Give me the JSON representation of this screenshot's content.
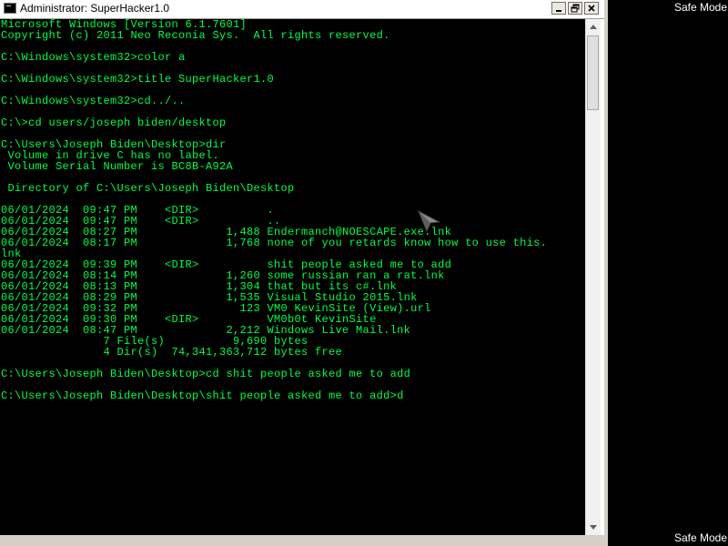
{
  "desktop": {
    "safe_mode_top": "Safe Mode",
    "safe_mode_bottom": "Safe Mode"
  },
  "window": {
    "title": "Administrator:  SuperHacker1.0",
    "buttons": {
      "minimize": "minimize-icon",
      "maximize": "maximize-icon",
      "close": "close-icon"
    }
  },
  "console": {
    "text_color": "#00ff40",
    "background": "#000000",
    "lines": [
      "Microsoft Windows [Version 6.1.7601]",
      "Copyright (c) 2011 Neo Reconia Sys.  All rights reserved.",
      "",
      "C:\\Windows\\system32>color a",
      "",
      "C:\\Windows\\system32>title SuperHacker1.0",
      "",
      "C:\\Windows\\system32>cd../..",
      "",
      "C:\\>cd users/joseph biden/desktop",
      "",
      "C:\\Users\\Joseph Biden\\Desktop>dir",
      " Volume in drive C has no label.",
      " Volume Serial Number is BC8B-A92A",
      "",
      " Directory of C:\\Users\\Joseph Biden\\Desktop",
      "",
      "06/01/2024  09:47 PM    <DIR>          .",
      "06/01/2024  09:47 PM    <DIR>          ..",
      "06/01/2024  08:27 PM             1,488 Endermanch@NOESCAPE.exe.lnk",
      "06/01/2024  08:17 PM             1,768 none of you retards know how to use this.",
      "lnk",
      "06/01/2024  09:39 PM    <DIR>          shit people asked me to add",
      "06/01/2024  08:14 PM             1,260 some russian ran a rat.lnk",
      "06/01/2024  08:13 PM             1,304 that but its c#.lnk",
      "06/01/2024  08:29 PM             1,535 Visual Studio 2015.lnk",
      "06/01/2024  09:32 PM               123 VM0 KevinSite (View).url",
      "06/01/2024  09:30 PM    <DIR>          VM0b0t KevinSite",
      "06/01/2024  08:47 PM             2,212 Windows Live Mail.lnk",
      "               7 File(s)          9,690 bytes",
      "               4 Dir(s)  74,341,363,712 bytes free",
      "",
      "C:\\Users\\Joseph Biden\\Desktop>cd shit people asked me to add",
      "",
      "C:\\Users\\Joseph Biden\\Desktop\\shit people asked me to add>d"
    ]
  },
  "scrollbar": {
    "up": "scroll-up-arrow-icon",
    "down": "scroll-down-arrow-icon"
  },
  "cursor": "mouse-pointer-icon"
}
